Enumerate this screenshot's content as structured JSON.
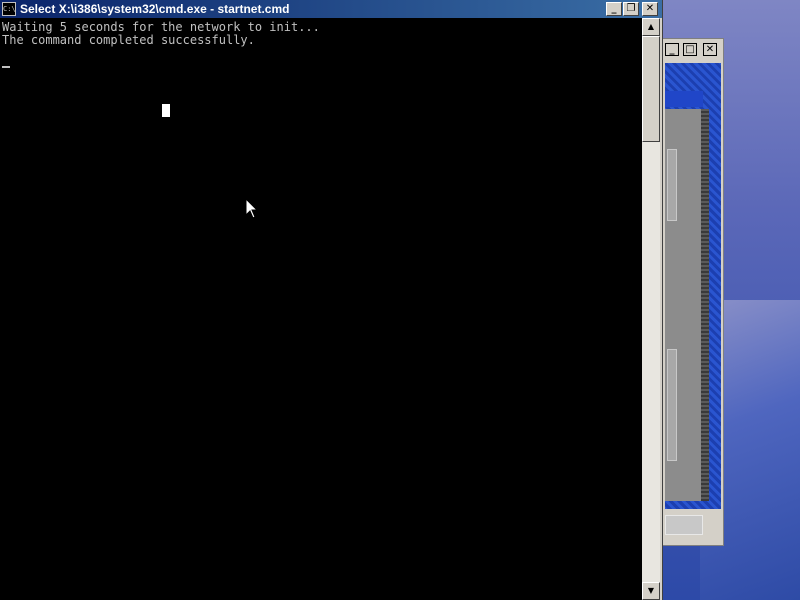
{
  "cmd_window": {
    "title": "Select X:\\i386\\system32\\cmd.exe - startnet.cmd",
    "icon_text": "C:\\",
    "buttons": {
      "minimize": "_",
      "restore": "❐",
      "close": "✕"
    },
    "console_lines": [
      "Waiting 5 seconds for the network to init...",
      "The command completed successfully."
    ],
    "scrollbar": {
      "up": "▲",
      "down": "▼"
    }
  },
  "background_window": {
    "buttons": {
      "minimize": "_",
      "maximize": "□",
      "close": "✕"
    }
  }
}
